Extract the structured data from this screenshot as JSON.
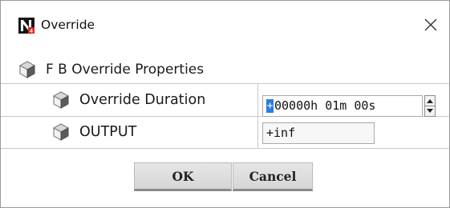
{
  "window": {
    "title": "Override",
    "app_icon": "niagara-n4-icon",
    "close_icon": "close-icon"
  },
  "properties": {
    "group_label": "F B Override Properties",
    "items": [
      {
        "label": "Override Duration",
        "value_sign": "+",
        "value": "00000h 01m 00s"
      },
      {
        "label": "OUTPUT",
        "value": "+inf"
      }
    ]
  },
  "buttons": {
    "ok_label": "OK",
    "cancel_label": "Cancel"
  },
  "colors": {
    "icon_red": "#d9261c",
    "caret_blue": "#2a7de1"
  }
}
